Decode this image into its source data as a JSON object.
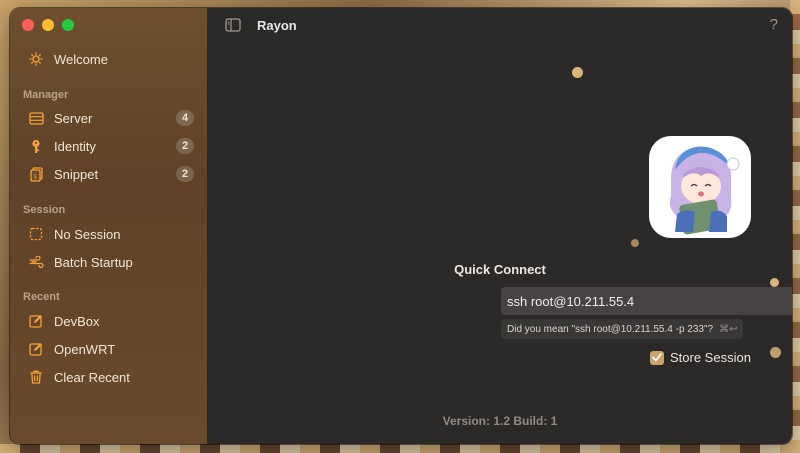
{
  "window": {
    "title": "Rayon",
    "help_label": "?"
  },
  "sidebar": {
    "welcome": {
      "label": "Welcome",
      "icon": "sun-icon"
    },
    "sections": {
      "manager": "Manager",
      "session": "Session",
      "recent": "Recent"
    },
    "manager_items": [
      {
        "label": "Server",
        "count": "4",
        "icon": "server-icon"
      },
      {
        "label": "Identity",
        "count": "2",
        "icon": "key-icon"
      },
      {
        "label": "Snippet",
        "count": "2",
        "icon": "snippet-icon"
      }
    ],
    "session_items": [
      {
        "label": "No Session",
        "icon": "dashed-square-icon"
      },
      {
        "label": "Batch Startup",
        "icon": "wind-icon"
      }
    ],
    "recent_items": [
      {
        "label": "DevBox",
        "icon": "edit-icon"
      },
      {
        "label": "OpenWRT",
        "icon": "edit-icon"
      },
      {
        "label": "Clear Recent",
        "icon": "trash-icon"
      }
    ]
  },
  "main": {
    "quick_connect_title": "Quick Connect",
    "command_value": "ssh root@10.211.55.4",
    "suggestion": "Did you mean \"ssh root@10.211.55.4 -p 233\"?",
    "suggestion_shortcut": "⌘↩",
    "store_session_label": "Store Session",
    "store_session_checked": true,
    "version_text": "Version: 1.2 Build: 1"
  },
  "colors": {
    "accent": "#f5a23a",
    "sidebar_bg": "#6e4f2e",
    "main_bg": "#2c2a29"
  }
}
